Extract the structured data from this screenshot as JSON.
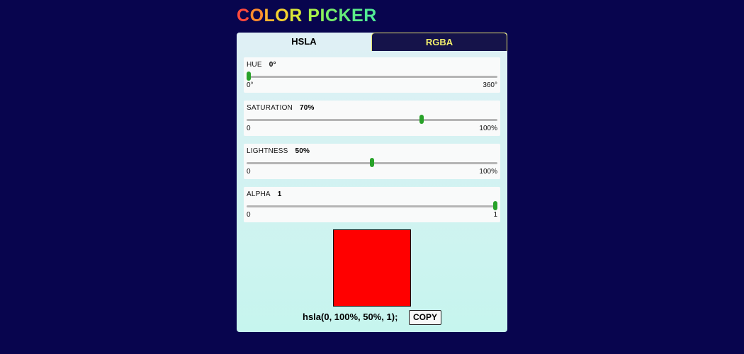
{
  "app": {
    "title_letters": [
      "C",
      "O",
      "L",
      "O",
      "R",
      " ",
      "P",
      "I",
      "C",
      "K",
      "E",
      "R"
    ],
    "title_colors": [
      "#ff4a3d",
      "#ff8c2e",
      "#ffb330",
      "#f5d230",
      "#d9e63a",
      "#c2ef3f",
      "#a8f04a",
      "#8cf05a",
      "#78ee6a",
      "#66ec7a",
      "#5beb88",
      "#52ea95"
    ]
  },
  "tabs": [
    {
      "label": "HSLA",
      "active": true
    },
    {
      "label": "RGBA",
      "active": false
    }
  ],
  "sliders": [
    {
      "label": "HUE",
      "value_text": "0°",
      "min_label": "0°",
      "max_label": "360°",
      "fraction": 0.0
    },
    {
      "label": "SATURATION",
      "value_text": "70%",
      "min_label": "0",
      "max_label": "100%",
      "fraction": 0.7
    },
    {
      "label": "LIGHTNESS",
      "value_text": "50%",
      "min_label": "0",
      "max_label": "100%",
      "fraction": 0.5
    },
    {
      "label": "ALPHA",
      "value_text": "1",
      "min_label": "0",
      "max_label": "1",
      "fraction": 1.0
    }
  ],
  "preview": {
    "color": "#ff0000"
  },
  "output": {
    "text": "hsla(0, 100%, 50%, 1);",
    "copy_label": "COPY"
  },
  "colors": {
    "background": "#08054e",
    "thumb": "#28a229",
    "track": "#b5b5b5",
    "rgba_tab_text": "#f2ef6c"
  }
}
